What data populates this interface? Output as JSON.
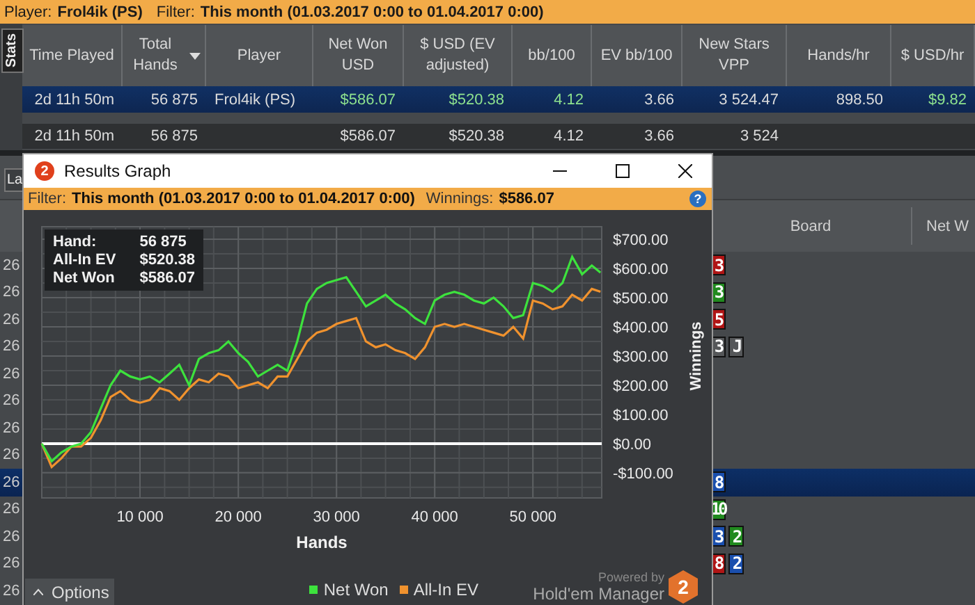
{
  "filter_bar": {
    "player_label": "Player:",
    "player": "Frol4ik (PS)",
    "filter_label": "Filter:",
    "filter": "This month (01.03.2017 0:00 to 01.04.2017 0:00)"
  },
  "side_tab": {
    "label": "Stats"
  },
  "stats_table": {
    "columns": [
      {
        "label": "Time Played",
        "sorted": false
      },
      {
        "label": "Total Hands",
        "sorted": true
      },
      {
        "label": "Player",
        "sorted": false
      },
      {
        "label": "Net Won USD",
        "sorted": false
      },
      {
        "label": "$ USD (EV adjusted)",
        "sorted": false
      },
      {
        "label": "bb/100",
        "sorted": false
      },
      {
        "label": "EV bb/100",
        "sorted": false
      },
      {
        "label": "New Stars VPP",
        "sorted": false
      },
      {
        "label": "Hands/hr",
        "sorted": false
      },
      {
        "label": "$ USD/hr",
        "sorted": false
      }
    ],
    "rows": [
      {
        "kind": "player",
        "selected": true,
        "cells": [
          {
            "text": "2d 11h 50m",
            "positive": false
          },
          {
            "text": "56 875",
            "positive": false
          },
          {
            "text": "Frol4ik (PS)",
            "positive": false
          },
          {
            "text": "$586.07",
            "positive": true
          },
          {
            "text": "$520.38",
            "positive": true
          },
          {
            "text": "4.12",
            "positive": true
          },
          {
            "text": "3.66",
            "positive": false
          },
          {
            "text": "3 524.47",
            "positive": false
          },
          {
            "text": "898.50",
            "positive": false
          },
          {
            "text": "$9.82",
            "positive": true
          }
        ]
      },
      {
        "kind": "total",
        "selected": false,
        "cells": [
          {
            "text": "2d 11h 50m",
            "positive": false
          },
          {
            "text": "56 875",
            "positive": false
          },
          null,
          {
            "text": "$586.07",
            "positive": false
          },
          {
            "text": "$520.38",
            "positive": false
          },
          {
            "text": "4.12",
            "positive": false
          },
          {
            "text": "3.66",
            "positive": false
          },
          {
            "text": "3 524",
            "positive": false
          },
          null,
          null
        ]
      }
    ]
  },
  "hands_panel": {
    "dropdown": {
      "value": "La"
    },
    "columns": [
      "Board",
      "Net W"
    ],
    "rows": [
      {
        "selected": false,
        "cell": "26",
        "board": [
          {
            "rank": "3",
            "color": "#b01515"
          }
        ]
      },
      {
        "selected": false,
        "cell": "26",
        "board": [
          {
            "rank": "3",
            "color": "#218a1f"
          }
        ]
      },
      {
        "selected": false,
        "cell": "26",
        "board": [
          {
            "rank": "5",
            "color": "#b01515"
          }
        ]
      },
      {
        "selected": false,
        "cell": "26",
        "board": [
          {
            "rank": "3",
            "color": "#555759"
          },
          {
            "rank": "J",
            "color": "#555759"
          }
        ]
      },
      {
        "selected": false,
        "cell": "26",
        "board": []
      },
      {
        "selected": false,
        "cell": "26",
        "board": []
      },
      {
        "selected": false,
        "cell": "26",
        "board": []
      },
      {
        "selected": false,
        "cell": "26",
        "board": []
      },
      {
        "selected": true,
        "cell": "26",
        "board": [
          {
            "rank": "8",
            "color": "#1a4fae"
          }
        ]
      },
      {
        "selected": false,
        "cell": "26",
        "board": [
          {
            "rank": "10",
            "color": "#218a1f"
          }
        ]
      },
      {
        "selected": false,
        "cell": "26",
        "board": [
          {
            "rank": "3",
            "color": "#1a4fae"
          },
          {
            "rank": "2",
            "color": "#218a1f"
          }
        ]
      },
      {
        "selected": false,
        "cell": "26",
        "board": [
          {
            "rank": "8",
            "color": "#b01515"
          },
          {
            "rank": "2",
            "color": "#1a4fae"
          }
        ]
      },
      {
        "selected": false,
        "cell": "26",
        "board": []
      }
    ]
  },
  "graph_window": {
    "app_icon": "2",
    "title": "Results Graph",
    "filter_label": "Filter:",
    "filter": "This month (01.03.2017 0:00 to 01.04.2017 0:00)",
    "winnings_label": "Winnings:",
    "winnings": "$586.07",
    "help": "?",
    "info": [
      {
        "label": "Hand:",
        "value": "56 875"
      },
      {
        "label": "All-In EV",
        "value": "$520.38"
      },
      {
        "label": "Net Won",
        "value": "$586.07"
      }
    ],
    "chart_data": {
      "type": "line",
      "grid": true,
      "xlabel": "Hands",
      "ylabel": "Winnings",
      "x": [
        0,
        1000,
        2000,
        3000,
        4000,
        5000,
        6000,
        7000,
        8000,
        9000,
        10000,
        11000,
        12000,
        13000,
        14000,
        15000,
        16000,
        17000,
        18000,
        19000,
        20000,
        21000,
        22000,
        23000,
        24000,
        25000,
        26000,
        27000,
        28000,
        29000,
        30000,
        31000,
        32000,
        33000,
        34000,
        35000,
        36000,
        37000,
        38000,
        39000,
        40000,
        41000,
        42000,
        43000,
        44000,
        45000,
        46000,
        47000,
        48000,
        49000,
        50000,
        51000,
        52000,
        53000,
        54000,
        55000,
        56000,
        56875
      ],
      "series": [
        {
          "name": "Net Won",
          "color": "#3de23d",
          "values": [
            0,
            -60,
            -30,
            -10,
            0,
            40,
            120,
            200,
            250,
            230,
            220,
            230,
            210,
            240,
            270,
            200,
            290,
            310,
            320,
            350,
            310,
            280,
            230,
            250,
            270,
            250,
            350,
            480,
            530,
            550,
            560,
            570,
            520,
            470,
            490,
            510,
            480,
            460,
            430,
            410,
            490,
            510,
            520,
            510,
            490,
            480,
            500,
            470,
            430,
            440,
            550,
            540,
            520,
            550,
            640,
            580,
            610,
            586
          ]
        },
        {
          "name": "All-In EV",
          "color": "#f0922e",
          "values": [
            0,
            -80,
            -50,
            -10,
            -10,
            20,
            80,
            160,
            180,
            150,
            140,
            150,
            190,
            180,
            150,
            190,
            220,
            210,
            240,
            230,
            190,
            200,
            210,
            190,
            230,
            230,
            290,
            350,
            380,
            390,
            410,
            420,
            430,
            350,
            330,
            340,
            320,
            310,
            290,
            330,
            400,
            410,
            400,
            410,
            400,
            390,
            380,
            370,
            400,
            360,
            490,
            480,
            460,
            470,
            510,
            490,
            530,
            520
          ]
        }
      ],
      "xlim": [
        0,
        57000
      ],
      "ylim": [
        -186,
        743
      ],
      "xticks": [
        {
          "value": 10000,
          "label": "10 000"
        },
        {
          "value": 20000,
          "label": "20 000"
        },
        {
          "value": 30000,
          "label": "30 000"
        },
        {
          "value": 40000,
          "label": "40 000"
        },
        {
          "value": 50000,
          "label": "50 000"
        }
      ],
      "yticks": [
        {
          "value": -100,
          "label": "-$100.00"
        },
        {
          "value": 0,
          "label": "$0.00"
        },
        {
          "value": 100,
          "label": "$100.00"
        },
        {
          "value": 200,
          "label": "$200.00"
        },
        {
          "value": 300,
          "label": "$300.00"
        },
        {
          "value": 400,
          "label": "$400.00"
        },
        {
          "value": 500,
          "label": "$500.00"
        },
        {
          "value": 600,
          "label": "$600.00"
        },
        {
          "value": 700,
          "label": "$700.00"
        }
      ]
    },
    "options_button": "Options",
    "branding": {
      "powered_by": "Powered by",
      "product": "Hold'em Manager",
      "logo": "2"
    }
  }
}
